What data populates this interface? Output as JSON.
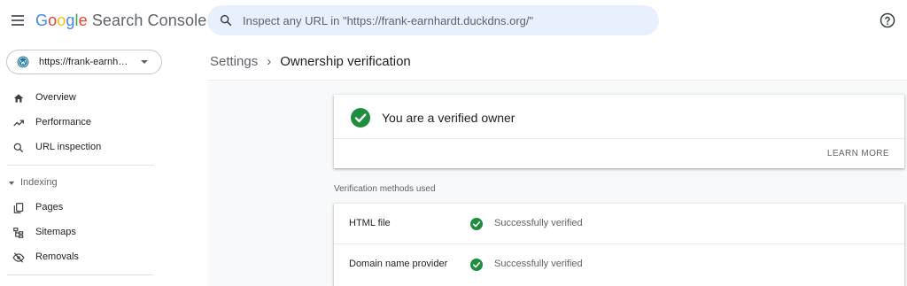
{
  "app": {
    "logo_letters": [
      "G",
      "o",
      "o",
      "g",
      "l",
      "e"
    ],
    "product_name": "Search Console"
  },
  "search": {
    "placeholder": "Inspect any URL in \"https://frank-earnhardt.duckdns.org/\""
  },
  "property": {
    "label": "https://frank-earnh…"
  },
  "sidebar": {
    "items": [
      {
        "label": "Overview",
        "icon": "home-icon"
      },
      {
        "label": "Performance",
        "icon": "trending-up-icon"
      },
      {
        "label": "URL inspection",
        "icon": "search-icon"
      }
    ],
    "indexing_header": "Indexing",
    "indexing_items": [
      {
        "label": "Pages",
        "icon": "pages-icon"
      },
      {
        "label": "Sitemaps",
        "icon": "sitemap-icon"
      },
      {
        "label": "Removals",
        "icon": "removals-icon"
      }
    ]
  },
  "breadcrumb": {
    "parent": "Settings",
    "separator": "›",
    "current": "Ownership verification"
  },
  "owner_card": {
    "title": "You are a verified owner",
    "learn_more": "LEARN MORE"
  },
  "methods": {
    "heading": "Verification methods used",
    "rows": [
      {
        "name": "HTML file",
        "status": "Successfully verified"
      },
      {
        "name": "Domain name provider",
        "status": "Successfully verified"
      }
    ]
  },
  "colors": {
    "success_green": "#1e8e3e",
    "search_bg": "#e8f0fe",
    "text_primary": "#202124",
    "text_secondary": "#5f6368"
  }
}
